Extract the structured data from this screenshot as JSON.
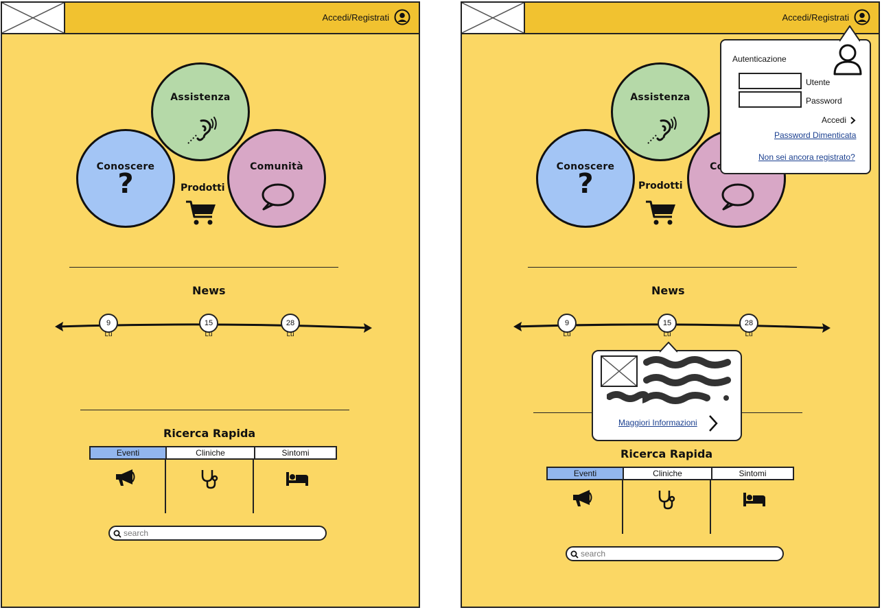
{
  "header": {
    "login_label": "Accedi/Registrati",
    "logo_icon": "image-placeholder-icon",
    "user_icon": "user-circle-icon"
  },
  "categories": {
    "assistenza": {
      "label": "Assistenza",
      "icon": "hearing-aid-icon"
    },
    "conoscere": {
      "label": "Conoscere",
      "icon": "question-mark-icon"
    },
    "comunita": {
      "label": "Comunità",
      "icon": "speech-bubble-icon"
    },
    "prodotti": {
      "label": "Prodotti",
      "icon": "shopping-cart-icon"
    }
  },
  "news": {
    "title": "News",
    "events": [
      {
        "day": "9",
        "weekday": "Lu"
      },
      {
        "day": "15",
        "weekday": "Lu"
      },
      {
        "day": "28",
        "weekday": "Lu"
      }
    ]
  },
  "ricerca": {
    "title": "Ricerca Rapida",
    "tabs": [
      {
        "label": "Eventi",
        "icon": "megaphone-icon",
        "active": true
      },
      {
        "label": "Cliniche",
        "icon": "stethoscope-icon",
        "active": false
      },
      {
        "label": "Sintomi",
        "icon": "bed-icon",
        "active": false
      }
    ],
    "search_placeholder": "search"
  },
  "login_popover": {
    "title": "Autenticazione",
    "user_label": "Utente",
    "password_label": "Password",
    "submit_label": "Accedi",
    "forgot_link": "Password Dimenticata",
    "register_link": "Non sei ancora registrato?"
  },
  "news_popover": {
    "more_info_link": "Maggiori Informazioni"
  },
  "colors": {
    "background": "#fbd764",
    "header": "#f1c230",
    "assistenza": "#b5d9a8",
    "conoscere": "#a3c5f5",
    "comunita": "#d8a7c6",
    "active_tab": "#92b6ee"
  }
}
